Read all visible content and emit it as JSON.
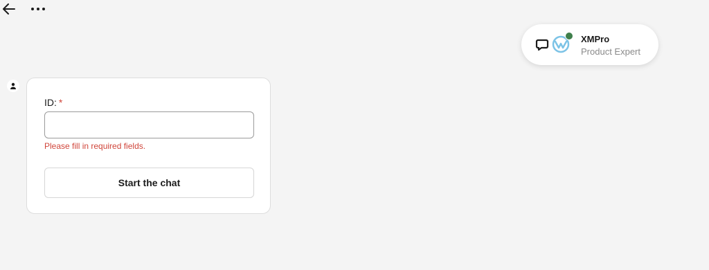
{
  "header": {
    "back_icon": "arrow-left-icon",
    "more_icon": "more-horizontal-icon"
  },
  "agent": {
    "name": "XMPro",
    "role": "Product Expert",
    "status": "online",
    "status_color": "#3f7f4b",
    "chat_icon": "chat-bubble-icon",
    "logo_icon": "xmpro-logo-icon"
  },
  "form": {
    "avatar_icon": "user-icon",
    "id_label": "ID:",
    "required_marker": "*",
    "id_value": "",
    "error_message": "Please fill in required fields.",
    "submit_label": "Start the chat"
  },
  "colors": {
    "error": "#d0453a",
    "background": "#f4f4f4",
    "card": "#ffffff"
  }
}
